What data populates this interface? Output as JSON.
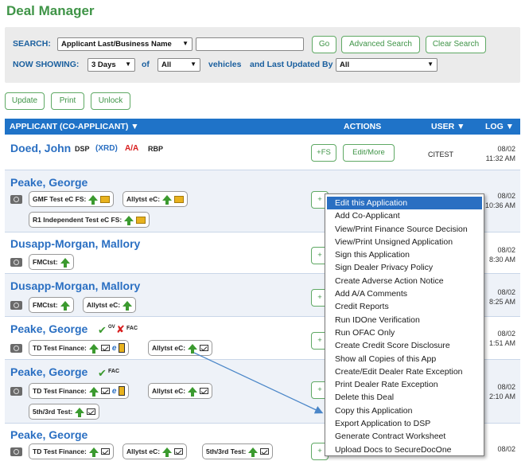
{
  "title": "Deal Manager",
  "search": {
    "label": "SEARCH:",
    "field_select": "Applicant Last/Business Name",
    "text_value": "",
    "go": "Go",
    "advanced": "Advanced Search",
    "clear": "Clear Search",
    "now_showing_label": "NOW SHOWING:",
    "days_select": "3 Days",
    "of_label": "of",
    "vehicle_select": "All",
    "vehicles_label": "vehicles",
    "updated_label": "and Last Updated By",
    "updated_select": "All"
  },
  "toolbar": {
    "update": "Update",
    "print": "Print",
    "unlock": "Unlock"
  },
  "table_headers": {
    "applicant": "APPLICANT (CO-APPLICANT) ▼",
    "actions": "ACTIONS",
    "user": "USER ▼",
    "log": "LOG ▼"
  },
  "rows": [
    {
      "name": "Doed, John",
      "tags": [
        "DSP",
        "(XRD)",
        "A/A",
        "RBP"
      ],
      "actions": [
        "+FS",
        "Edit/More"
      ],
      "user": "CITEST",
      "log_date": "08/02",
      "log_time": "11:32 AM"
    },
    {
      "name": "Peake, George",
      "pills": [
        "GMF Test eC FS:",
        "Allytst eC:",
        "R1 Independent Test eC FS:"
      ],
      "actions": [
        "+"
      ],
      "log_date": "08/02",
      "log_time": "10:36 AM"
    },
    {
      "name": "Dusapp-Morgan, Mallory",
      "pills": [
        "FMCtst:"
      ],
      "actions": [
        "+"
      ],
      "log_date": "08/02",
      "log_time": "8:30 AM"
    },
    {
      "name": "Dusapp-Morgan, Mallory",
      "pills": [
        "FMCtst:",
        "Allytst eC:"
      ],
      "actions": [
        "+"
      ],
      "log_date": "08/02",
      "log_time": "8:25 AM"
    },
    {
      "name": "Peake, George",
      "badges": [
        "OV",
        "FAC"
      ],
      "pills": [
        "TD Test Finance:",
        "Allytst eC:"
      ],
      "actions": [
        "+"
      ],
      "log_date": "08/02",
      "log_time": "1:51 AM"
    },
    {
      "name": "Peake, George",
      "badges": [
        "FAC"
      ],
      "pills": [
        "TD Test Finance:",
        "Allytst eC:",
        "5th/3rd Test:"
      ],
      "actions": [
        "+"
      ],
      "log_date": "08/02",
      "log_time": "2:10 AM"
    },
    {
      "name": "Peake, George",
      "pills": [
        "TD Test Finance:",
        "Allytst eC:",
        "5th/3rd Test:"
      ],
      "actions": [
        "+"
      ],
      "log_date": "08/02",
      "log_time": ""
    }
  ],
  "context_menu": [
    "Edit this Application",
    "Add Co-Applicant",
    "View/Print Finance Source Decision",
    "View/Print Unsigned Application",
    "Sign this Application",
    "Sign Dealer Privacy Policy",
    "Create Adverse Action Notice",
    "Add A/A Comments",
    "Credit Reports",
    "Run IDOne Verification",
    "Run OFAC Only",
    "Create Credit Score Disclosure",
    "Show all Copies of this App",
    "Create/Edit Dealer Rate Exception",
    "Print Dealer Rate Exception",
    "Delete this Deal",
    "Copy this Application",
    "Export Application to DSP",
    "Generate Contract Worksheet",
    "Upload Docs to SecureDocOne"
  ],
  "colors": {
    "brand_green": "#3f9447",
    "header_blue": "#1f73c8",
    "link_blue": "#2a6fc2",
    "alert_red": "#d81e1e",
    "menu_highlight": "#2a6fc2"
  }
}
